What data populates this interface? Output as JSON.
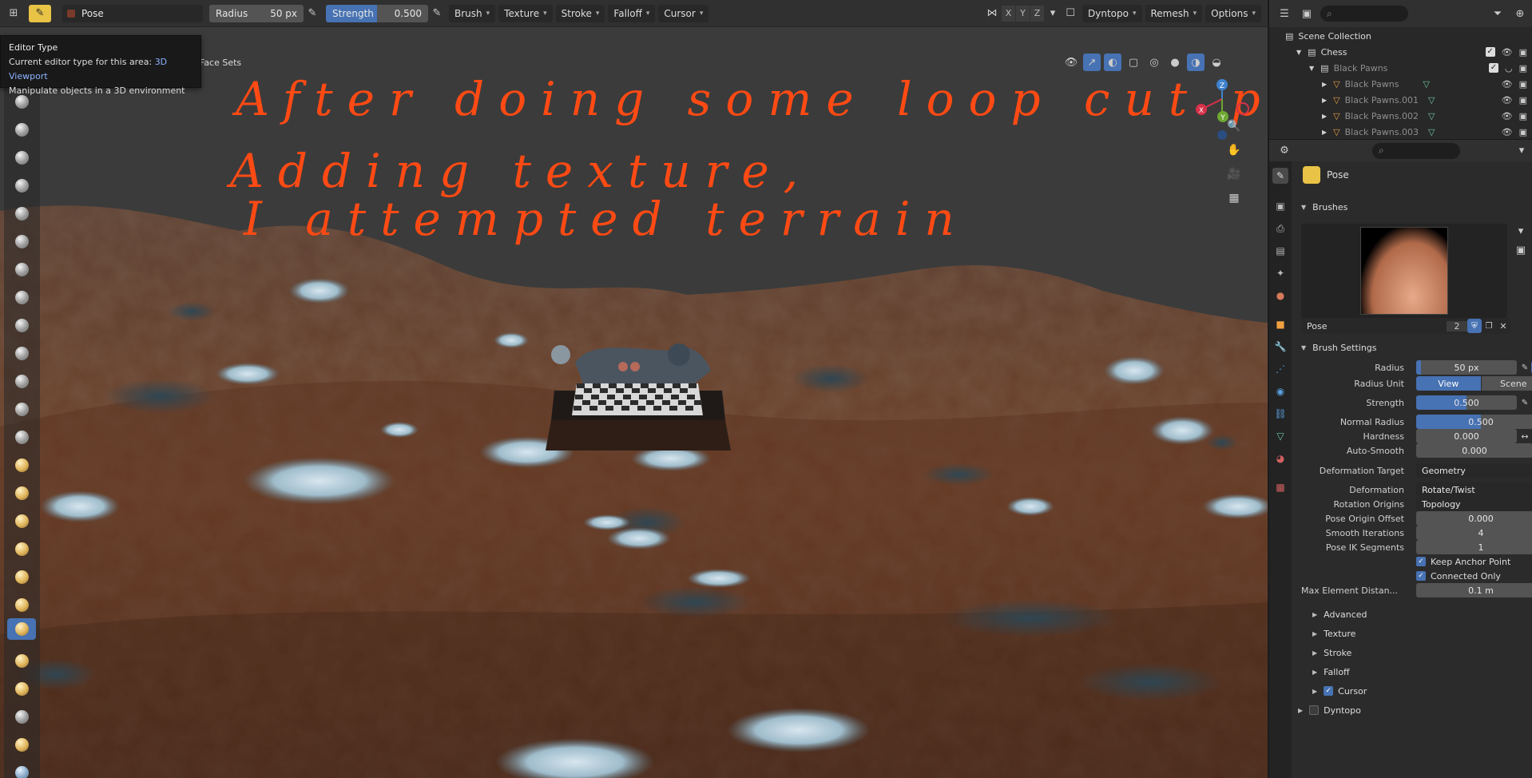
{
  "header": {
    "mode_label": "Pose",
    "radius": {
      "label": "Radius",
      "value": "50 px"
    },
    "strength": {
      "label": "Strength",
      "value": "0.500",
      "fraction": 0.5
    },
    "menus": [
      "Brush",
      "Texture",
      "Stroke",
      "Falloff",
      "Cursor"
    ],
    "axes": [
      "X",
      "Y",
      "Z"
    ],
    "right_menus": [
      "Dyntopo",
      "Remesh",
      "Options"
    ]
  },
  "tooltip": {
    "title": "Editor Type",
    "line2_prefix": "Current editor type for this area:",
    "line2_value": "3D Viewport",
    "line3": "Manipulate objects in a 3D environment"
  },
  "viewport": {
    "face_sets_label": "Face Sets",
    "annotation_lines": [
      "After doing some loop cut pairs,",
      "Adding texture,",
      "I attempted terrain"
    ],
    "gizmo_axes": [
      "X",
      "Y",
      "Z"
    ]
  },
  "outliner": {
    "root": "Scene Collection",
    "collection": "Chess",
    "items": [
      {
        "name": "Black Pawns",
        "level": 2
      },
      {
        "name": "Black Pawns",
        "level": 3
      },
      {
        "name": "Black Pawns.001",
        "level": 3
      },
      {
        "name": "Black Pawns.002",
        "level": 3
      },
      {
        "name": "Black Pawns.003",
        "level": 3
      }
    ]
  },
  "properties": {
    "tool_name": "Pose",
    "brushes_label": "Brushes",
    "brush_name": "Pose",
    "brush_users": "2",
    "brush_settings_label": "Brush Settings",
    "radius": {
      "label": "Radius",
      "value": "50 px",
      "fraction": 0.05
    },
    "radius_unit": {
      "label": "Radius Unit",
      "options": [
        "View",
        "Scene"
      ],
      "selected": "View"
    },
    "strength": {
      "label": "Strength",
      "value": "0.500",
      "fraction": 0.5
    },
    "normal_radius": {
      "label": "Normal Radius",
      "value": "0.500",
      "fraction": 0.5
    },
    "hardness": {
      "label": "Hardness",
      "value": "0.000"
    },
    "auto_smooth": {
      "label": "Auto-Smooth",
      "value": "0.000"
    },
    "deformation_target": {
      "label": "Deformation Target",
      "value": "Geometry"
    },
    "deformation": {
      "label": "Deformation",
      "value": "Rotate/Twist"
    },
    "rotation_origins": {
      "label": "Rotation Origins",
      "value": "Topology"
    },
    "pose_origin_offset": {
      "label": "Pose Origin Offset",
      "value": "0.000"
    },
    "smooth_iterations": {
      "label": "Smooth Iterations",
      "value": "4"
    },
    "pose_ik_segments": {
      "label": "Pose IK Segments",
      "value": "1"
    },
    "keep_anchor_point": {
      "label": "Keep Anchor Point",
      "checked": true
    },
    "connected_only": {
      "label": "Connected Only",
      "checked": true
    },
    "max_element_distance": {
      "label": "Max Element Distan...",
      "value": "0.1 m"
    },
    "subpanels": [
      "Advanced",
      "Texture",
      "Stroke",
      "Falloff",
      "Cursor"
    ],
    "dyntopo_label": "Dyntopo"
  },
  "colors": {
    "accent": "#4772b3",
    "annotation": "#ff4a14",
    "axis_x": "#d8304a",
    "axis_y": "#6ea832",
    "axis_z": "#3f82d0"
  }
}
